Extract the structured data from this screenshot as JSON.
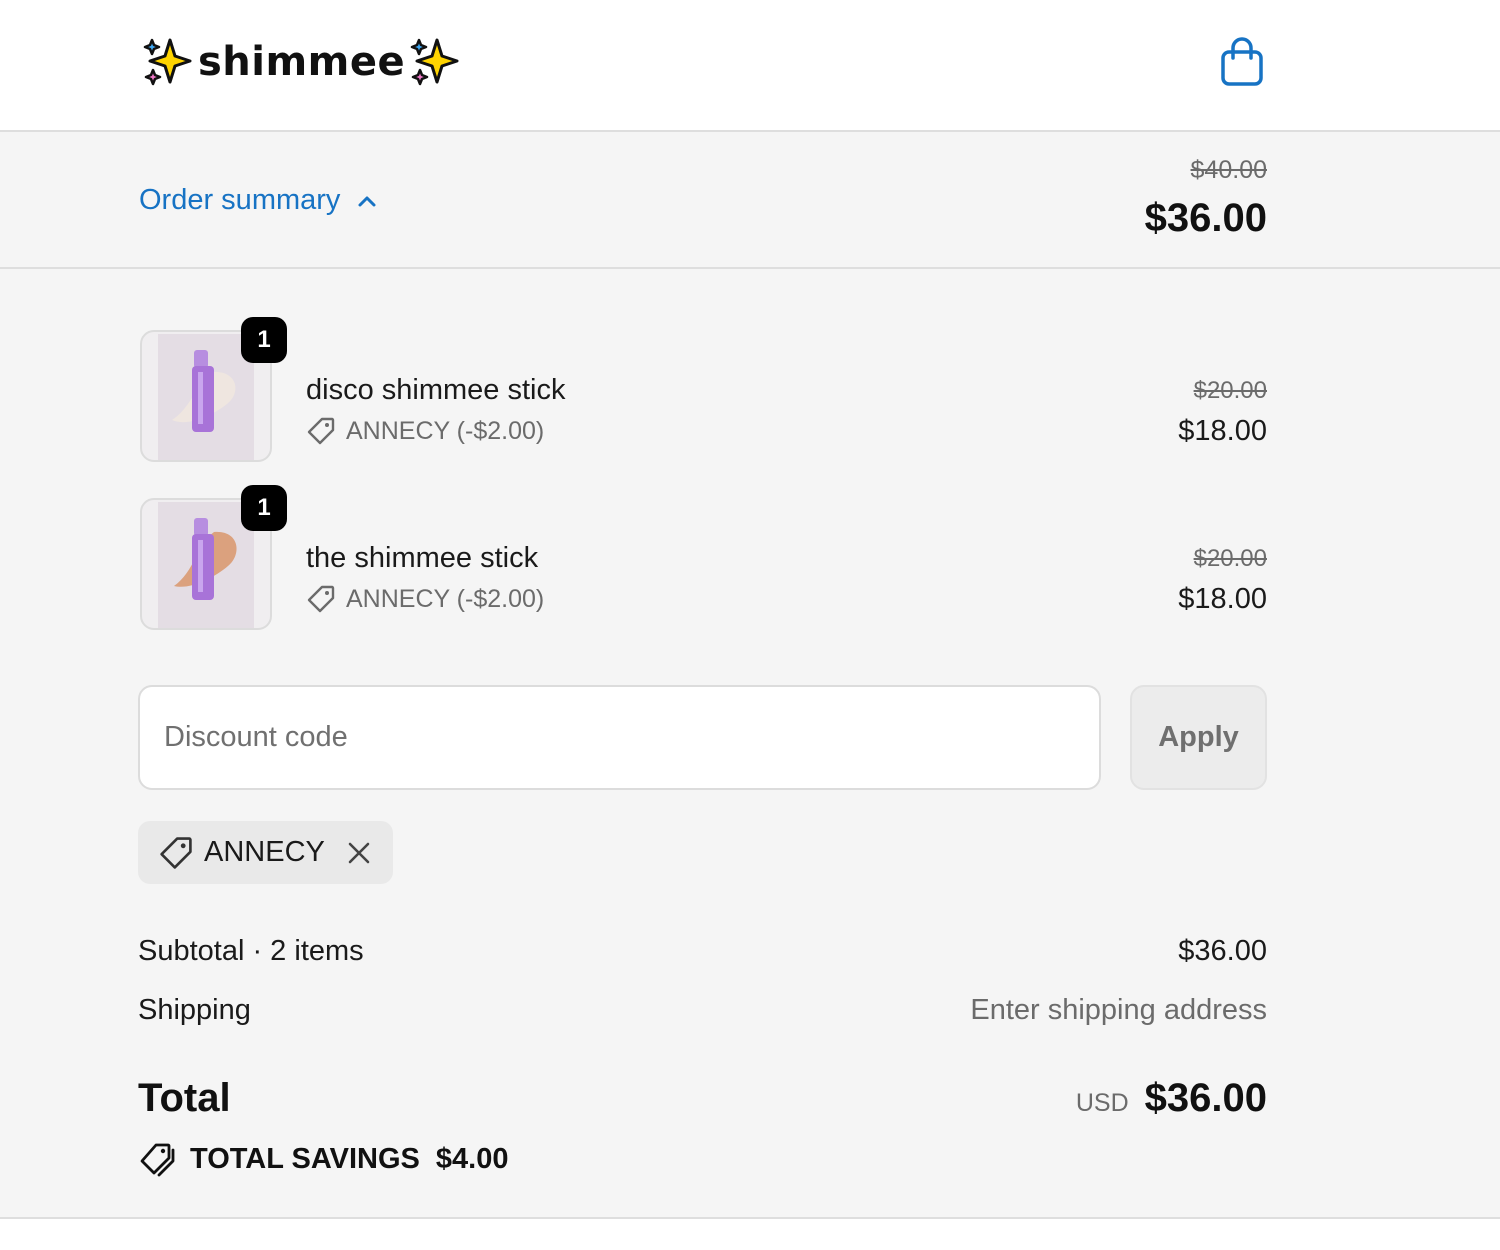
{
  "header": {
    "brand": "shimmee",
    "cart_icon": "shopping-bag-icon",
    "sparkle_icon": "sparkles-icon"
  },
  "summary": {
    "toggle_label": "Order summary",
    "toggle_icon": "chevron-up-icon",
    "original_total": "$40.00",
    "total": "$36.00"
  },
  "items": [
    {
      "name": "disco shimmee stick",
      "quantity": "1",
      "discount": "ANNECY (-$2.00)",
      "original_price": "$20.00",
      "price": "$18.00"
    },
    {
      "name": "the shimmee stick",
      "quantity": "1",
      "discount": "ANNECY (-$2.00)",
      "original_price": "$20.00",
      "price": "$18.00"
    }
  ],
  "discount": {
    "placeholder": "Discount code",
    "value": "",
    "apply_label": "Apply",
    "applied_code": "ANNECY"
  },
  "totals": {
    "subtotal_label": "Subtotal · 2 items",
    "subtotal_value": "$36.00",
    "shipping_label": "Shipping",
    "shipping_value": "Enter shipping address",
    "total_label": "Total",
    "currency": "USD",
    "total_value": "$36.00",
    "savings_label": "TOTAL SAVINGS",
    "savings_value": "$4.00"
  },
  "colors": {
    "accent": "#1773c4",
    "panel": "#f5f5f5",
    "text": "#1a1a1a",
    "muted": "#6b6b6b"
  }
}
